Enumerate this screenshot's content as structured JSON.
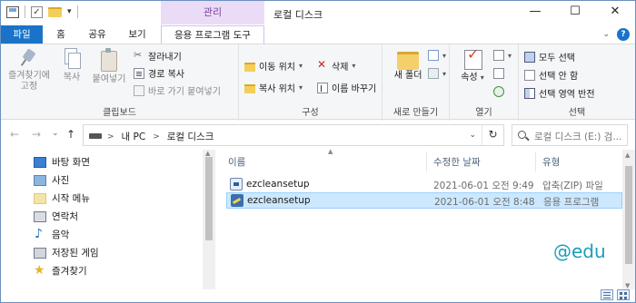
{
  "title_bar": {
    "context_tab_label": "관리",
    "window_title": "로컬 디스크",
    "minimize": "—",
    "maximize": "☐",
    "close": "✕",
    "qat_dropdown": "▾"
  },
  "ribbon_tabs": {
    "file": "파일",
    "home": "홈",
    "share": "공유",
    "view": "보기",
    "app_tools": "응용 프로그램 도구",
    "collapse_chevron": "⌄",
    "help": "?"
  },
  "clipboard": {
    "pin": "즐겨찾기에 고정",
    "copy": "복사",
    "paste": "붙여넣기",
    "cut": "잘라내기",
    "copy_path": "경로 복사",
    "paste_shortcut": "바로 가기 붙여넣기",
    "group_label": "클립보드"
  },
  "organize": {
    "move_to": "이동 위치",
    "copy_to": "복사 위치",
    "delete": "삭제",
    "rename": "이름 바꾸기",
    "group_label": "구성"
  },
  "new": {
    "new_folder": "새 폴더",
    "group_label": "새로 만들기"
  },
  "open": {
    "properties": "속성",
    "group_label": "열기"
  },
  "select": {
    "select_all": "모두 선택",
    "select_none": "선택 안 함",
    "invert_selection": "선택 영역 반전",
    "group_label": "선택"
  },
  "address_bar": {
    "back": "←",
    "forward": "→",
    "recent": "⌄",
    "up": "↑",
    "crumbs": [
      "내 PC",
      "로컬 디스크"
    ],
    "sep": ">",
    "dropdown": "⌄",
    "refresh": "↻",
    "search_placeholder": "로컬 디스크 (E:) 검..."
  },
  "nav_pane": {
    "items": [
      {
        "label": "바탕 화면",
        "icon": "desktop-icon"
      },
      {
        "label": "사진",
        "icon": "pictures-icon"
      },
      {
        "label": "시작 메뉴",
        "icon": "start-menu-icon"
      },
      {
        "label": "연락처",
        "icon": "contacts-icon"
      },
      {
        "label": "음악",
        "icon": "music-icon"
      },
      {
        "label": "저장된 게임",
        "icon": "saved-games-icon"
      },
      {
        "label": "즐겨찾기",
        "icon": "favorites-icon"
      }
    ]
  },
  "file_list": {
    "columns": {
      "name": "이름",
      "date": "수정한 날짜",
      "type": "유형"
    },
    "rows": [
      {
        "name": "ezcleansetup",
        "date": "2021-06-01 오전 9:49",
        "type": "압축(ZIP) 파일",
        "icon": "zip-file-icon",
        "selected": false
      },
      {
        "name": "ezcleansetup",
        "date": "2021-06-01 오전 8:48",
        "type": "응용 프로그램",
        "icon": "application-icon",
        "selected": true
      }
    ]
  },
  "watermark": "@edu",
  "colors": {
    "accent": "#1a73c9",
    "context_tab": "#eadcf6",
    "selection": "#cce8ff",
    "watermark": "#1b9cbd"
  }
}
